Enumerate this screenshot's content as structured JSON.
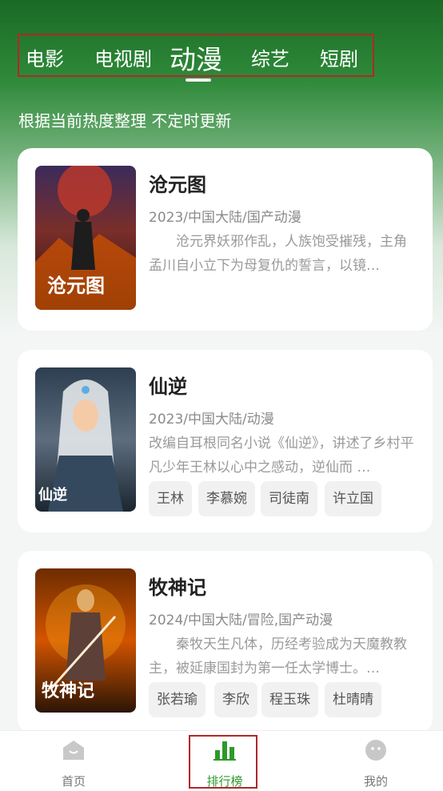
{
  "tabs": [
    "电影",
    "电视剧",
    "动漫",
    "综艺",
    "短剧"
  ],
  "active_tab": "动漫",
  "subtitle": "根据当前热度整理 不定时更新",
  "cards": [
    {
      "title": "沧元图",
      "meta": "2023/中国大陆/国产动漫",
      "desc": "沧元界妖邪作乱，人族饱受摧残，主角孟川自小立下为母复仇的誓言，以镜…",
      "poster_text": "沧元图",
      "cast": []
    },
    {
      "title": "仙逆",
      "meta": "2023/中国大陆/动漫",
      "desc": "改编自耳根同名小说《仙逆》，讲述了乡村平凡少年王林以心中之感动，逆仙而 …",
      "poster_text": "仙逆",
      "cast": [
        "王林",
        "李慕婉",
        "司徒南",
        "许立国"
      ]
    },
    {
      "title": "牧神记",
      "meta": "2024/中国大陆/冒险,国产动漫",
      "desc": "秦牧天生凡体，历经考验成为天魔教教主，被延康国封为第一任太学博士。…",
      "poster_text": "牧神记",
      "cast": [
        "张若瑜",
        "李欣",
        "程玉珠",
        "杜晴晴"
      ]
    }
  ],
  "nav": [
    {
      "label": "首页",
      "icon": "home-icon"
    },
    {
      "label": "排行榜",
      "icon": "ranking-icon"
    },
    {
      "label": "我的",
      "icon": "profile-icon"
    }
  ],
  "colors": {
    "accent": "#2c9a2a",
    "header_green": "#1a6a25",
    "highlight_border": "#b0272a"
  }
}
